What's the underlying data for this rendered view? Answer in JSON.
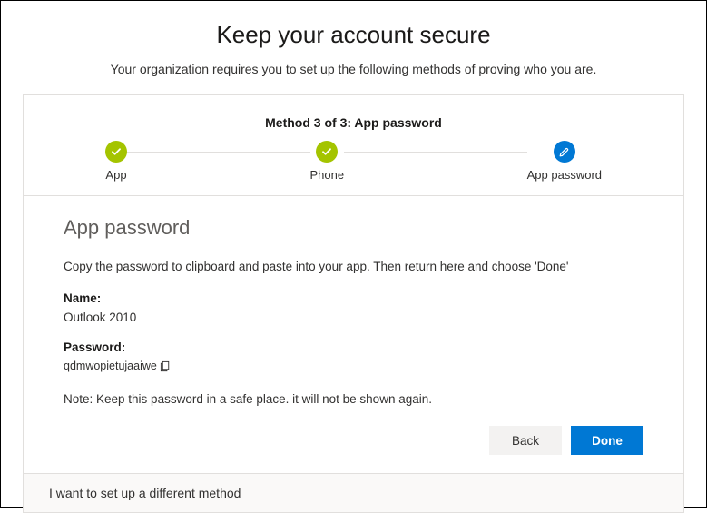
{
  "header": {
    "title": "Keep your account secure",
    "subtitle": "Your organization requires you to set up the following methods of proving who you are."
  },
  "stepper": {
    "method_title": "Method 3 of 3: App password",
    "steps": [
      {
        "label": "App",
        "state": "done"
      },
      {
        "label": "Phone",
        "state": "done"
      },
      {
        "label": "App password",
        "state": "current"
      }
    ]
  },
  "section": {
    "heading": "App password",
    "instruction": "Copy the password to clipboard and paste into your app. Then return here and choose 'Done'",
    "name_label": "Name:",
    "name_value": "Outlook 2010",
    "password_label": "Password:",
    "password_value": "qdmwopietujaaiwe",
    "note": "Note: Keep this password in a safe place. it will not be shown again."
  },
  "actions": {
    "back": "Back",
    "done": "Done"
  },
  "footer": {
    "alt_method": "I want to set up a different method"
  }
}
